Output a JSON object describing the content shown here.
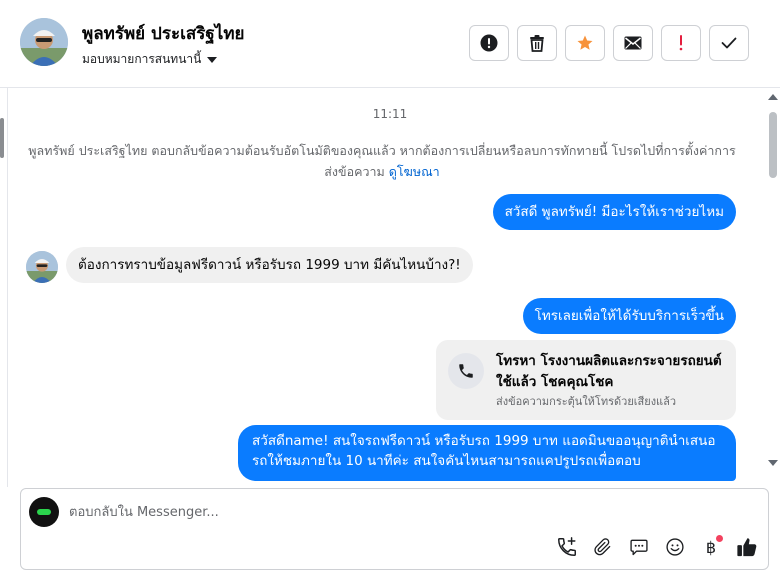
{
  "header": {
    "contact_name": "พูลทรัพย์ ประเสริฐไทย",
    "assign_label": "มอบหมายการสนทนานี้",
    "actions": [
      {
        "icon": "alert-circle-icon"
      },
      {
        "icon": "trash-icon"
      },
      {
        "icon": "star-icon",
        "color": "#f7923a"
      },
      {
        "icon": "mail-icon"
      },
      {
        "icon": "exclamation-icon",
        "color": "#e41e3f"
      },
      {
        "icon": "check-icon"
      }
    ]
  },
  "thread": {
    "timestamp": "11:11",
    "notice_text": "พูลทรัพย์ ประเสริฐไทย ตอบกลับข้อความต้อนรับอัตโนมัติของคุณแล้ว หากต้องการเปลี่ยนหรือลบการทักทายนี้ โปรดไปที่การตั้งค่าการส่งข้อความ",
    "notice_link": "ดูโฆษณา",
    "messages": [
      {
        "direction": "out",
        "text": "สวัสดี พูลทรัพย์! มีอะไรให้เราช่วยไหม"
      },
      {
        "direction": "in",
        "text": "ต้องการทราบข้อมูลฟรีดาวน์ หรือรับรถ 1999 บาท มีคันไหนบ้าง?!"
      },
      {
        "direction": "out",
        "text": "โทรเลยเพื่อให้ได้รับบริการเร็วขึ้น"
      },
      {
        "direction": "out",
        "type": "call_card",
        "title": "โทรหา โรงงานผลิตและกระจายรถยนต์ใช้แล้ว โชคคุณโชค",
        "subtitle": "ส่งข้อความกระตุ้นให้โทรด้วยเสียงแล้ว"
      },
      {
        "direction": "out",
        "text": "สวัสดีname! สนใจรถฟรีดาวน์ หรือรับรถ 1999 บาท แอดมินขออนุญาตินำเสนอรถให้ชมภายใน 10 นาทีค่ะ สนใจคันไหนสามารถแคปรูปรถเพื่อตอบ"
      }
    ]
  },
  "composer": {
    "placeholder": "ตอบกลับใน Messenger...",
    "tools": [
      "add-call-icon",
      "attach-icon",
      "saved-replies-icon",
      "emoji-icon",
      "baht-payment-icon",
      "thumbs-up-icon"
    ],
    "baht_symbol": "฿"
  },
  "colors": {
    "accent": "#0a7cff",
    "incoming_bubble": "#f0f0f0",
    "link": "#0064d1"
  }
}
